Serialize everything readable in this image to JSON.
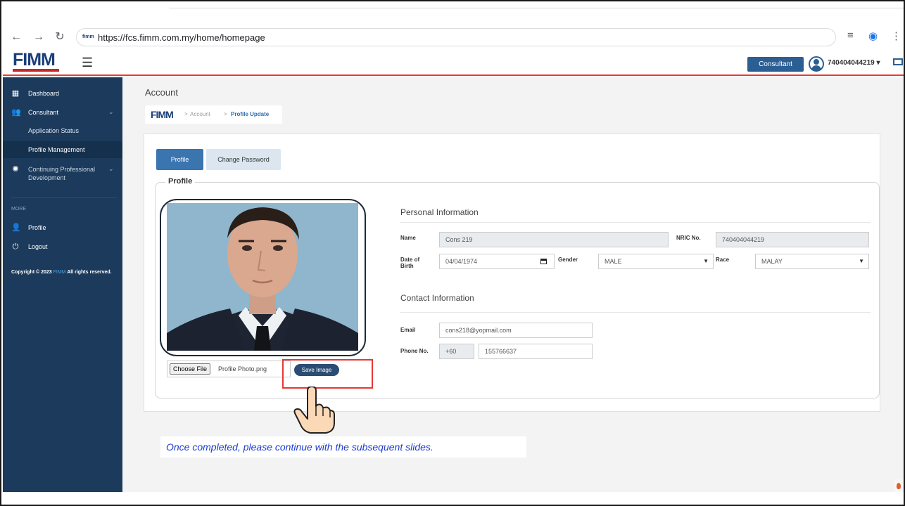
{
  "browser": {
    "url": "https://fcs.fimm.com.my/home/homepage",
    "favicon_text": "fimm"
  },
  "header": {
    "logo_text": "FIMM",
    "role_label": "Consultant",
    "user_id": "740404044219"
  },
  "sidebar": {
    "items": [
      {
        "label": "Dashboard",
        "icon": "dashboard-icon"
      },
      {
        "label": "Consultant",
        "icon": "users-icon"
      },
      {
        "label": "Application Status"
      },
      {
        "label": "Profile Management"
      },
      {
        "label": "Continuing Professional",
        "label2": "Development",
        "icon": "gear-icon"
      }
    ],
    "more_label": "MORE",
    "profile_label": "Profile",
    "logout_label": "Logout",
    "copyright_prefix": "Copyright © 2023",
    "copyright_brand": "FIMM",
    "copyright_suffix": "All rights reserved."
  },
  "main": {
    "page_title": "Account",
    "breadcrumb": {
      "logo": "FIMM",
      "sep": ">",
      "account": "Account",
      "current": "Profile Update"
    },
    "tabs": {
      "profile": "Profile",
      "change_password": "Change Password"
    },
    "legend": "Profile",
    "file": {
      "choose_label": "Choose File",
      "file_name": "Profile Photo.png"
    },
    "save_image_label": "Save Image",
    "personal": {
      "heading": "Personal Information",
      "name_label": "Name",
      "name_value": "Cons 219",
      "nric_label": "NRIC No.",
      "nric_value": "740404044219",
      "dob_label_1": "Date of",
      "dob_label_2": "Birth",
      "dob_value": "04/04/1974",
      "gender_label": "Gender",
      "gender_value": "MALE",
      "race_label": "Race",
      "race_value": "MALAY"
    },
    "contact": {
      "heading": "Contact Information",
      "email_label": "Email",
      "email_value": "cons218@yopmail.com",
      "phone_label": "Phone No.",
      "phone_code": "+60",
      "phone_value": "155766637"
    }
  },
  "note": "Once completed, please continue with the subsequent slides.",
  "colors": {
    "sidebar": "#1b3a5c",
    "primary": "#2b5f93",
    "highlight": "#e53935",
    "note": "#1d3bd0"
  }
}
